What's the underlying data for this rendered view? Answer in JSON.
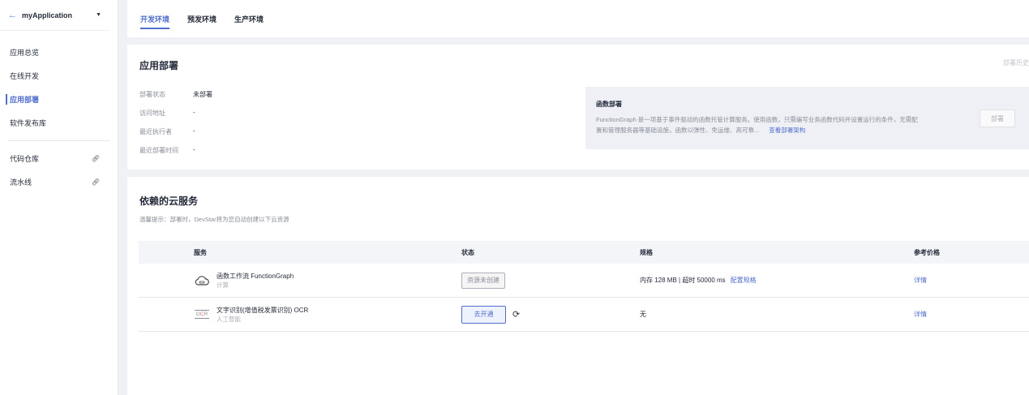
{
  "app": {
    "name": "myApplication"
  },
  "sidebar": {
    "items": [
      {
        "label": "应用总览"
      },
      {
        "label": "在线开发"
      },
      {
        "label": "应用部署"
      },
      {
        "label": "软件发布库"
      },
      {
        "label": "代码仓库"
      },
      {
        "label": "流水线"
      }
    ]
  },
  "tabs": [
    {
      "label": "开发环境"
    },
    {
      "label": "预发环境"
    },
    {
      "label": "生产环境"
    }
  ],
  "deploy": {
    "title": "应用部署",
    "history": "部署历史",
    "fields": [
      {
        "key": "部署状态",
        "value": "未部署"
      },
      {
        "key": "访问地址",
        "value": "-"
      },
      {
        "key": "最近执行者",
        "value": "-"
      },
      {
        "key": "最近部署时间",
        "value": "-"
      }
    ],
    "function": {
      "title": "函数部署",
      "desc": "FunctionGraph 是一项基于事件驱动的函数托管计算服务。使用函数，只需编写业务函数代码并设置运行的条件，无需配置和管理服务器等基础设施，函数以弹性、免运维、高可靠...",
      "link": "查看部署架构",
      "button": "部署"
    }
  },
  "services": {
    "title": "依赖的云服务",
    "tip": "温馨提示：部署时，DevStar将为您自动创建以下云资源",
    "columns": {
      "service": "服务",
      "status": "状态",
      "spec": "规格",
      "price": "参考价格"
    },
    "rows": [
      {
        "name": "函数工作流 FunctionGraph",
        "category": "计算",
        "status": "资源未创建",
        "spec": "内存 128 MB | 超时 50000 ms",
        "spec_link": "配置规格",
        "price": "详情"
      },
      {
        "name": "文字识别(增值税发票识别) OCR",
        "category": "人工智能",
        "status": "去开通",
        "spec": "无",
        "spec_link": "",
        "price": "详情"
      }
    ]
  }
}
